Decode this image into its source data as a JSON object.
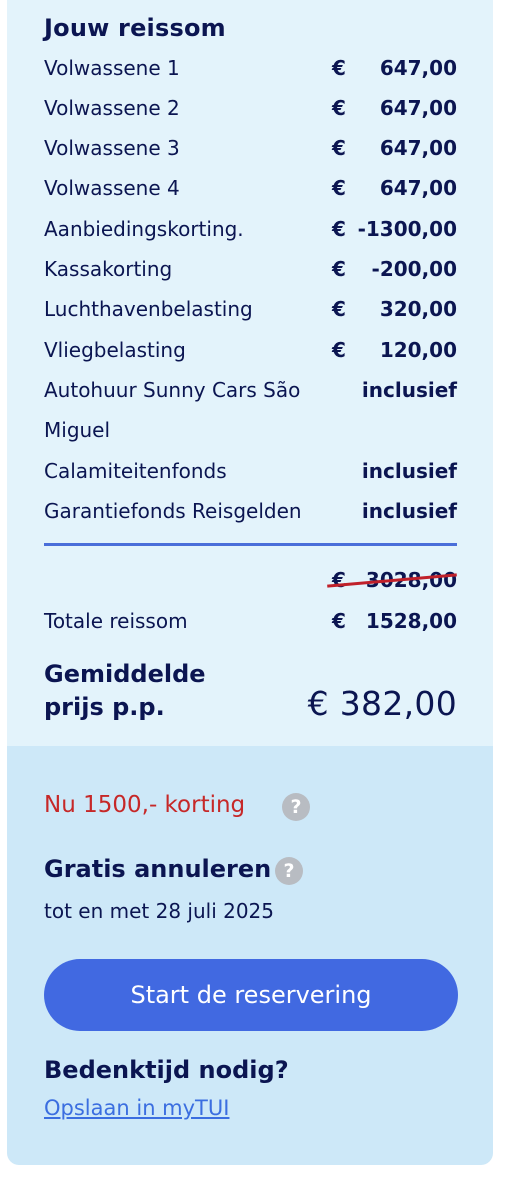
{
  "summary": {
    "title": "Jouw reissom",
    "rows": [
      {
        "label": "Volwassene 1",
        "currency": "€",
        "amount": "647,00"
      },
      {
        "label": "Volwassene 2",
        "currency": "€",
        "amount": "647,00"
      },
      {
        "label": "Volwassene 3",
        "currency": "€",
        "amount": "647,00"
      },
      {
        "label": "Volwassene 4",
        "currency": "€",
        "amount": "647,00"
      },
      {
        "label": "Aanbiedingskorting.",
        "currency": "€",
        "amount": "-1300,00"
      },
      {
        "label": "Kassakorting",
        "currency": "€",
        "amount": "-200,00"
      },
      {
        "label": "Luchthavenbelasting",
        "currency": "€",
        "amount": "320,00"
      },
      {
        "label": "Vliegbelasting",
        "currency": "€",
        "amount": "120,00"
      }
    ],
    "included": [
      {
        "label": "Autohuur Sunny Cars São Miguel",
        "value": "inclusief"
      },
      {
        "label": "Calamiteitenfonds",
        "value": "inclusief"
      },
      {
        "label": "Garantiefonds Reisgelden",
        "value": "inclusief"
      }
    ],
    "old_total": {
      "currency": "€",
      "amount": "3028,00"
    },
    "total": {
      "label": "Totale reissom",
      "currency": "€",
      "amount": "1528,00"
    },
    "average": {
      "label": "Gemiddelde prijs p.p.",
      "price": "€ 382,00"
    }
  },
  "offer": {
    "discount": "Nu 1500,- korting",
    "cancel_title": "Gratis annuleren",
    "cancel_sub": "tot en met 28 juli 2025",
    "cta_label": "Start de reservering",
    "think_title": "Bedenktijd nodig?",
    "save_link": "Opslaan in myTUI",
    "help_glyph": "?"
  },
  "colors": {
    "top_bg": "#e3f3fb",
    "bottom_bg": "#cde8f8",
    "text": "#0b1551",
    "accent": "#4169e1",
    "discount": "#c62828",
    "link": "#3b6ee0"
  }
}
